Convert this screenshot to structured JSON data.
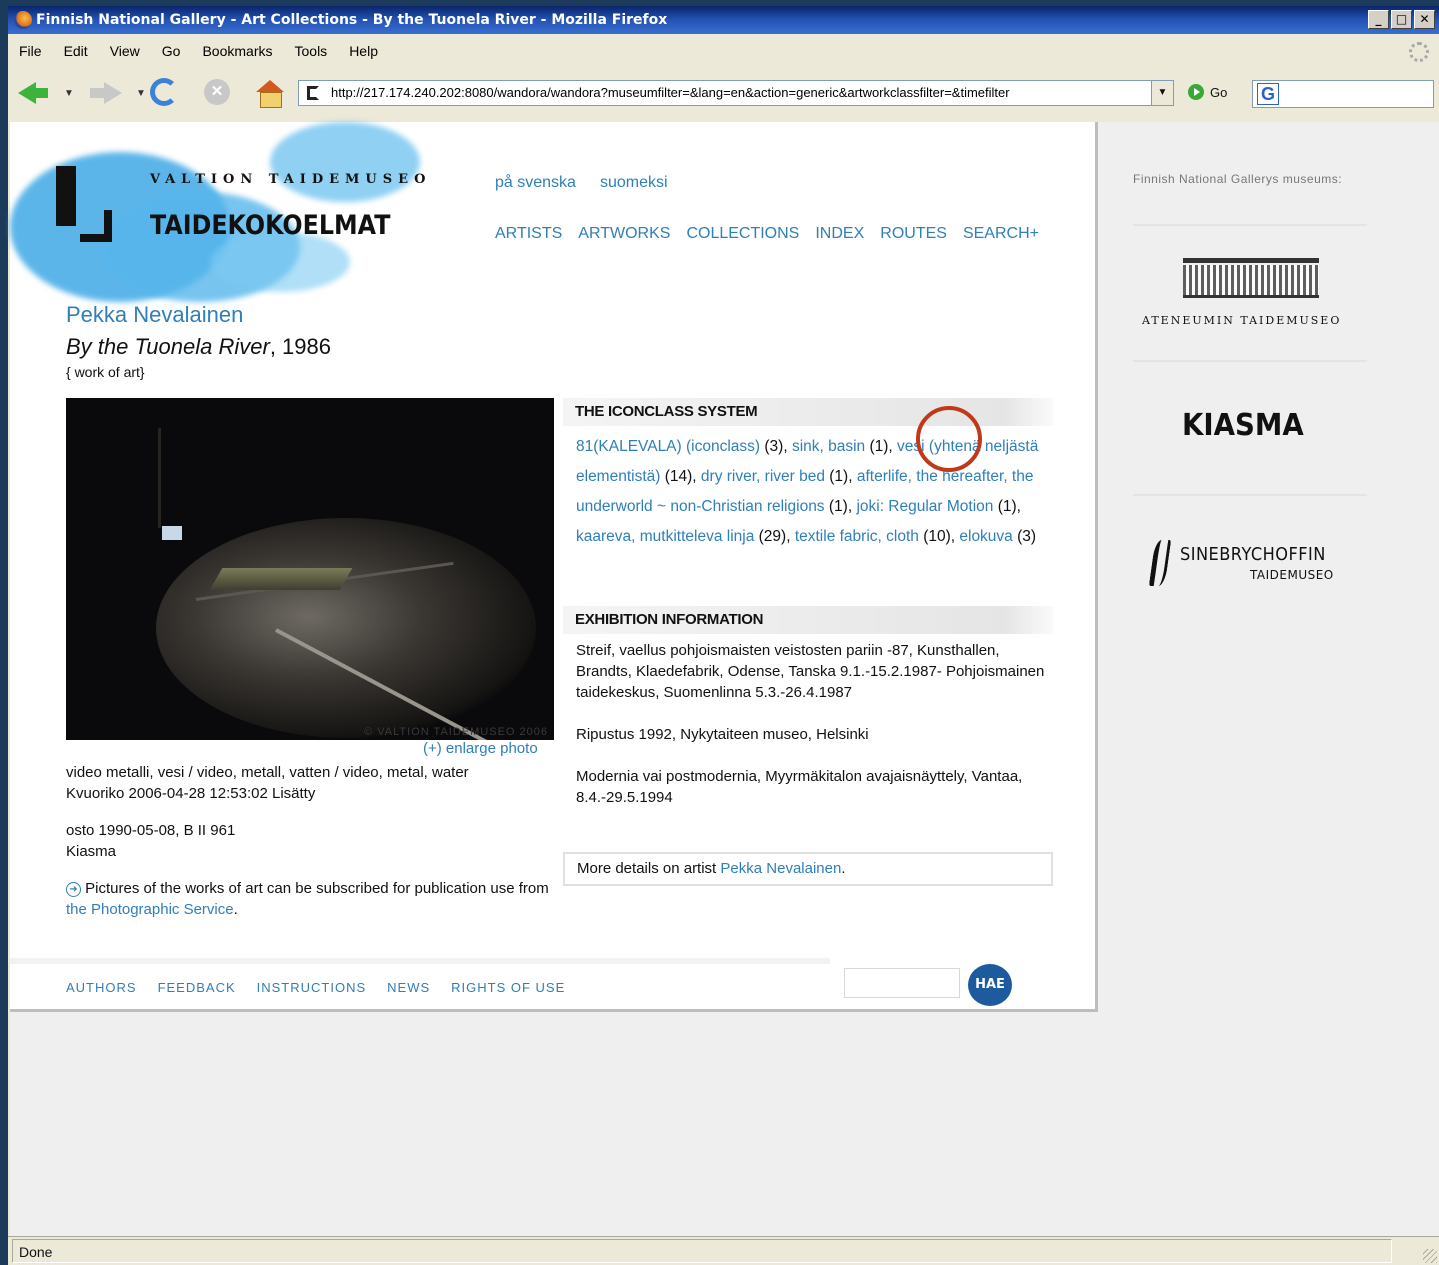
{
  "window": {
    "title": "Finnish National Gallery - Art Collections - By the Tuonela River - Mozilla Firefox",
    "controls": [
      "_",
      "□",
      "✕"
    ]
  },
  "menu": [
    "File",
    "Edit",
    "View",
    "Go",
    "Bookmarks",
    "Tools",
    "Help"
  ],
  "toolbar": {
    "url": "http://217.174.240.202:8080/wandora/wandora?museumfilter=&lang=en&action=generic&artworkclassfilter=&timefilter",
    "go_label": "Go",
    "search_engine_icon": "G"
  },
  "site": {
    "logo_top": "VALTION TAIDEMUSEO",
    "logo_bottom": "TAIDEKOKOELMAT",
    "lang_links": [
      "på svenska",
      "suomeksi"
    ],
    "nav": [
      "ARTISTS",
      "ARTWORKS",
      "COLLECTIONS",
      "INDEX",
      "ROUTES",
      "SEARCH+"
    ]
  },
  "artwork": {
    "artist": "Pekka Nevalainen",
    "title": "By the Tuonela River",
    "year": ", 1986",
    "type": "{  work of art}",
    "photo_copyright": "© VALTION TAIDEMUSEO 2006",
    "enlarge": "(+) enlarge photo",
    "technique": "video metalli, vesi / video, metall, vatten / video, metal, water",
    "added": "Kvuoriko 2006-04-28 12:53:02 Lisätty",
    "acquisition": "osto 1990-05-08, B II 961",
    "museum": "Kiasma",
    "photo_note_prefix": "Pictures of the works of art can be subscribed for publication use from ",
    "photo_note_link": "the Photographic Service",
    "photo_note_suffix": "."
  },
  "iconclass": {
    "heading": "THE ICONCLASS SYSTEM",
    "items": [
      {
        "term": "81(KALEVALA) (iconclass)",
        "count": " (3), "
      },
      {
        "term": "sink, basin",
        "count": " (1), "
      },
      {
        "term": "vesi (yhtenä neljästä elementistä)",
        "count": " (14), "
      },
      {
        "term": "dry river, river bed",
        "count": " (1), "
      },
      {
        "term": "afterlife, the hereafter, the underworld ~ non-Christian religions",
        "count": " (1), "
      },
      {
        "term": "joki: Regular Motion",
        "count": " (1), "
      },
      {
        "term": "kaareva, mutkitteleva linja",
        "count": " (29), "
      },
      {
        "term": "textile fabric, cloth",
        "count": " (10), "
      },
      {
        "term": "elokuva",
        "count": " (3)"
      }
    ]
  },
  "exhibition": {
    "heading": "EXHIBITION INFORMATION",
    "entries": [
      "Streif, vaellus pohjoismaisten veistosten pariin -87, Kunsthallen, Brandts, Klaedefabrik, Odense, Tanska 9.1.-15.2.1987- Pohjoismainen taidekeskus, Suomenlinna 5.3.-26.4.1987",
      "Ripustus 1992, Nykytaiteen museo, Helsinki",
      "Modernia vai postmodernia, Myyrmäkitalon avajaisnäyttely, Vantaa, 8.4.-29.5.1994"
    ]
  },
  "more": {
    "prefix": "More details on artist ",
    "link": "Pekka Nevalainen",
    "suffix": "."
  },
  "footer": {
    "links": [
      "AUTHORS",
      "FEEDBACK",
      "INSTRUCTIONS",
      "NEWS",
      "RIGHTS OF USE"
    ],
    "search_button": "HAE"
  },
  "sidebar": {
    "title": "Finnish National Gallerys museums:",
    "museums": [
      "ATENEUMIN TAIDEMUSEO",
      "KIASMA",
      "SINEBRYCHOFFIN",
      "TAIDEMUSEO"
    ]
  },
  "status": "Done",
  "colors": {
    "link": "#2f7fb8",
    "highlight_circle": "#c0391b"
  }
}
